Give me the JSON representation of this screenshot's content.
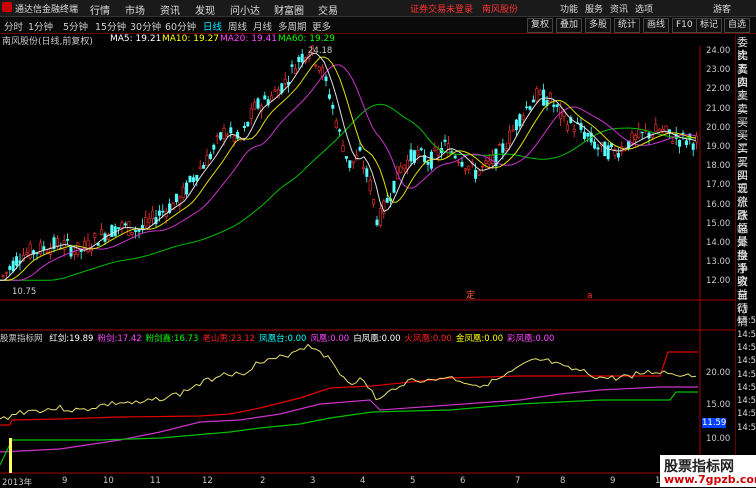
{
  "app": {
    "title": "通达信金融终端"
  },
  "menu": [
    "行情",
    "市场",
    "资讯",
    "发现",
    "问小达",
    "财富圈",
    "交易"
  ],
  "warning": "证券交易未登录",
  "stock_link": "南风股份",
  "top_right": [
    "功能",
    "服务",
    "资讯",
    "选项",
    "游客"
  ],
  "toolbar": {
    "periods": [
      "分时",
      "1分钟",
      "5分钟",
      "15分钟",
      "30分钟",
      "60分钟",
      "日线",
      "周线",
      "月线",
      "多周期",
      "更多"
    ],
    "active_period": "日线",
    "right_buttons": [
      "复权",
      "叠加",
      "多股",
      "统计",
      "画线",
      "F10",
      "标记",
      "自选"
    ]
  },
  "info": {
    "stock": "南风股份(日线,前复权)",
    "ma5": "MA5: 19.21",
    "ma10": "MA10: 19.27",
    "ma20": "MA20: 19.41",
    "ma60": "MA60: 19.29",
    "high_label": "24.18",
    "low_label": "10.75"
  },
  "indicator_line": {
    "name": "股票指标网",
    "items": [
      {
        "label": "红剑:",
        "value": "19.89",
        "color": "#ffffff"
      },
      {
        "label": "粉剑:",
        "value": "17.42",
        "color": "#ff44ff"
      },
      {
        "label": "粉剑鑫:",
        "value": "16.73",
        "color": "#00ff00"
      },
      {
        "label": "老山男:",
        "value": "23.12",
        "color": "#ff2020"
      },
      {
        "label": "凤凰台:",
        "value": "0.00",
        "color": "#00ffff"
      },
      {
        "label": "凤凰:",
        "value": "0.00",
        "color": "#ff44ff"
      },
      {
        "label": "白凤凰:",
        "value": "0.00",
        "color": "#ffffff"
      },
      {
        "label": "火凤凰:",
        "value": "0.00",
        "color": "#ff2020"
      },
      {
        "label": "金凤凰:",
        "value": "0.00",
        "color": "#ffff00"
      },
      {
        "label": "彩凤凰:",
        "value": "0.00",
        "color": "#ff44ff"
      }
    ]
  },
  "price_axis": [
    "24.00",
    "23.00",
    "22.00",
    "21.00",
    "20.00",
    "19.00",
    "18.00",
    "17.00",
    "16.00",
    "15.00",
    "14.00",
    "13.00",
    "12.00"
  ],
  "ind_axis": [
    "20.00",
    "15.00",
    "11.59",
    "10.00"
  ],
  "x_axis": [
    "2013年",
    "9",
    "10",
    "11",
    "12",
    "2",
    "3",
    "4",
    "5",
    "6",
    "7",
    "8",
    "9",
    "10",
    "11"
  ],
  "right_panel": [
    "委比",
    "卖五",
    "卖四",
    "卖三",
    "卖二",
    "卖一",
    "买一",
    "买二",
    "买三",
    "买四",
    "买五",
    "现价",
    "涨跌",
    "涨幅",
    "总量",
    "外盘",
    "换手",
    "净资",
    "收益",
    "自动",
    "行情",
    "14:50",
    "14:50",
    "14:50",
    "14:50",
    "14:50",
    "14:50",
    "14:50",
    "14:50",
    "14:50"
  ],
  "watermark": {
    "title": "股票指标网",
    "url": "www.7gpzb.com"
  },
  "markers": [
    "定",
    "a"
  ]
}
